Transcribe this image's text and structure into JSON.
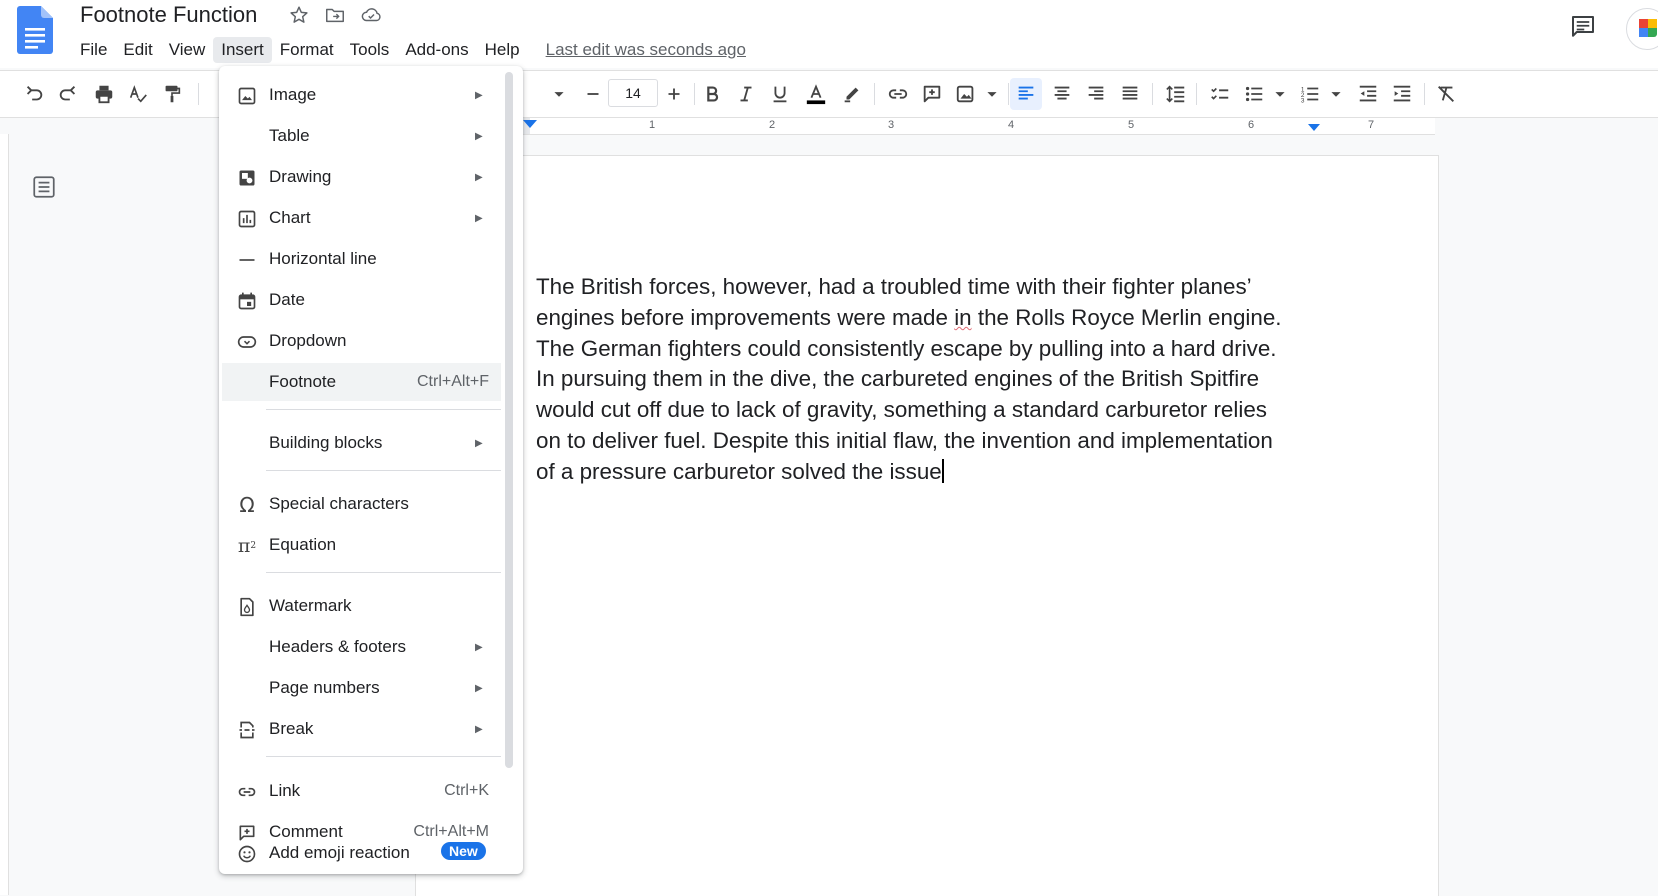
{
  "document": {
    "title": "Footnote Function",
    "last_edit": "Last edit was seconds ago"
  },
  "menubar": {
    "items": [
      "File",
      "Edit",
      "View",
      "Insert",
      "Format",
      "Tools",
      "Add-ons",
      "Help"
    ],
    "active": "Insert"
  },
  "toolbar": {
    "font_size": "14"
  },
  "ruler": {
    "numbers": [
      "1",
      "2",
      "3",
      "4",
      "5",
      "6",
      "7"
    ]
  },
  "insert_menu": {
    "items": [
      {
        "label": "Image",
        "icon": "image-icon",
        "submenu": true
      },
      {
        "label": "Table",
        "icon": "",
        "submenu": true
      },
      {
        "label": "Drawing",
        "icon": "drawing-icon",
        "submenu": true
      },
      {
        "label": "Chart",
        "icon": "chart-icon",
        "submenu": true
      },
      {
        "label": "Horizontal line",
        "icon": "horizontal-line-icon",
        "submenu": false
      },
      {
        "label": "Date",
        "icon": "calendar-icon",
        "submenu": false
      },
      {
        "label": "Dropdown",
        "icon": "dropdown-chip-icon",
        "submenu": false
      },
      {
        "label": "Footnote",
        "icon": "",
        "shortcut": "Ctrl+Alt+F",
        "highlighted": true
      },
      {
        "label": "Building blocks",
        "icon": "",
        "submenu": true
      },
      {
        "label": "Special characters",
        "icon": "omega-icon",
        "submenu": false
      },
      {
        "label": "Equation",
        "icon": "pi-icon",
        "submenu": false
      },
      {
        "label": "Watermark",
        "icon": "watermark-icon",
        "submenu": false
      },
      {
        "label": "Headers & footers",
        "icon": "",
        "submenu": true
      },
      {
        "label": "Page numbers",
        "icon": "",
        "submenu": true
      },
      {
        "label": "Break",
        "icon": "page-break-icon",
        "submenu": true
      },
      {
        "label": "Link",
        "icon": "link-icon",
        "shortcut": "Ctrl+K"
      },
      {
        "label": "Comment",
        "icon": "add-comment-icon",
        "shortcut": "Ctrl+Alt+M"
      },
      {
        "label": "Add emoji reaction",
        "icon": "emoji-icon",
        "badge": "New"
      }
    ]
  },
  "body_text": {
    "lines": [
      "The British forces, however, had a troubled time with their fighter planes’",
      "engines before improvements were made in the Rolls Royce Merlin engine.",
      "The German fighters could consistently escape by pulling into a hard drive.",
      "In pursuing them in the dive, the carbureted engines of the British Spitfire",
      "would cut off due to lack of gravity, something a standard carburetor relies",
      "on to deliver fuel. Despite this initial flaw, the invention and implementation",
      "of a pressure carburetor solved the issue"
    ],
    "line2_before": "engines before improvements were made ",
    "line2_misspelled": "in",
    "line2_after": " the Rolls Royce Merlin engine."
  },
  "colors": {
    "accent": "#1a73e8",
    "docs_blue": "#4285f4",
    "text_color_bar": "#000000"
  }
}
